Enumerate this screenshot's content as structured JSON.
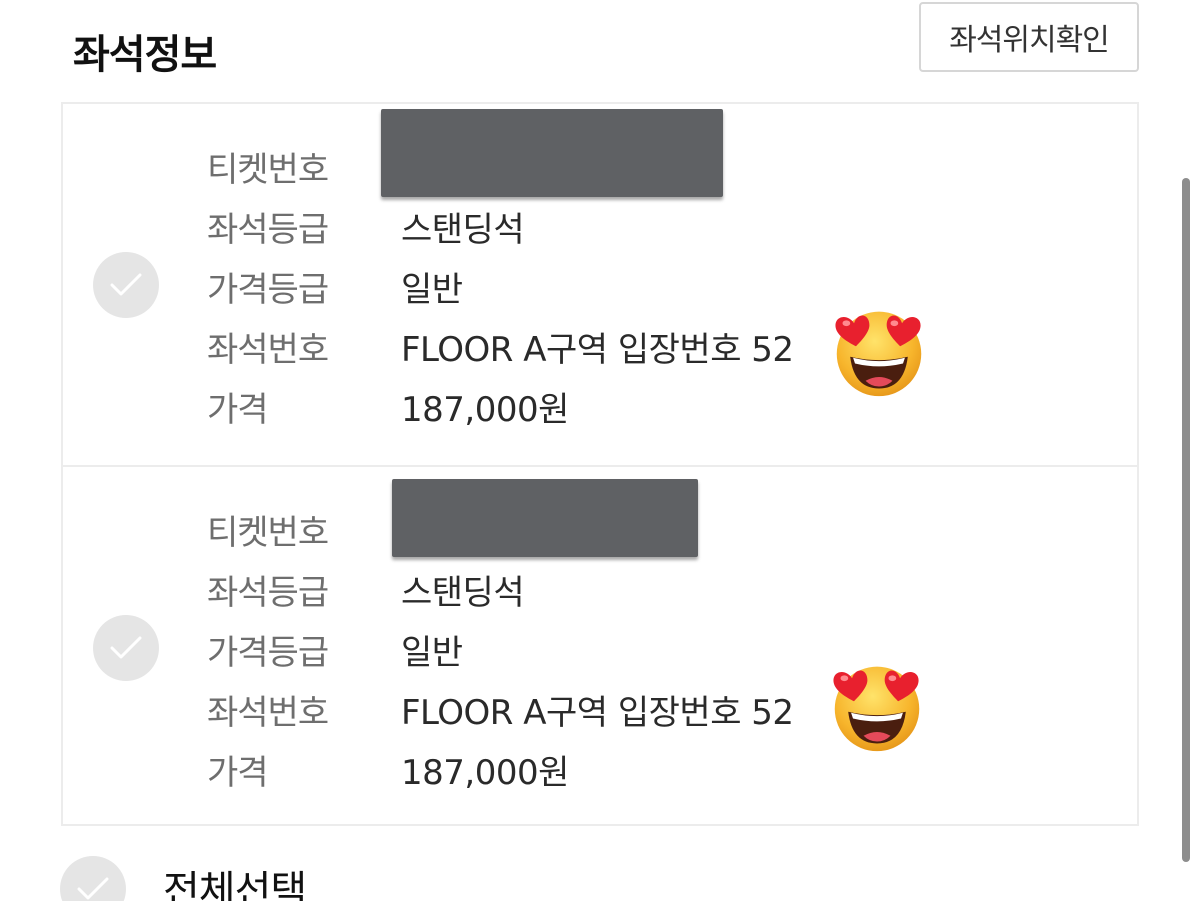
{
  "header": {
    "title": "좌석정보",
    "seat_map_button": "좌석위치확인"
  },
  "tickets": [
    {
      "ticket_no_label": "티켓번호",
      "seat_grade_label": "좌석등급",
      "seat_grade": "스탠딩석",
      "price_grade_label": "가격등급",
      "price_grade": "일반",
      "seat_no_label": "좌석번호",
      "seat_no": "FLOOR A구역 입장번호 52",
      "price_label": "가격",
      "price": "187,000원",
      "checked": false
    },
    {
      "ticket_no_label": "티켓번호",
      "seat_grade_label": "좌석등급",
      "seat_grade": "스탠딩석",
      "price_grade_label": "가격등급",
      "price_grade": "일반",
      "seat_no_label": "좌석번호",
      "seat_no": "FLOOR A구역 입장번호 52",
      "price_label": "가격",
      "price": "187,000원",
      "checked": false
    }
  ],
  "select_all": {
    "label": "전체선택",
    "checked": false
  },
  "icons": {
    "check": "checkmark-icon",
    "emoji": "heart-eyes-emoji-icon"
  },
  "colors": {
    "check_bg": "#e5e5e5",
    "redaction": "#5f6164",
    "border": "#ececec"
  }
}
